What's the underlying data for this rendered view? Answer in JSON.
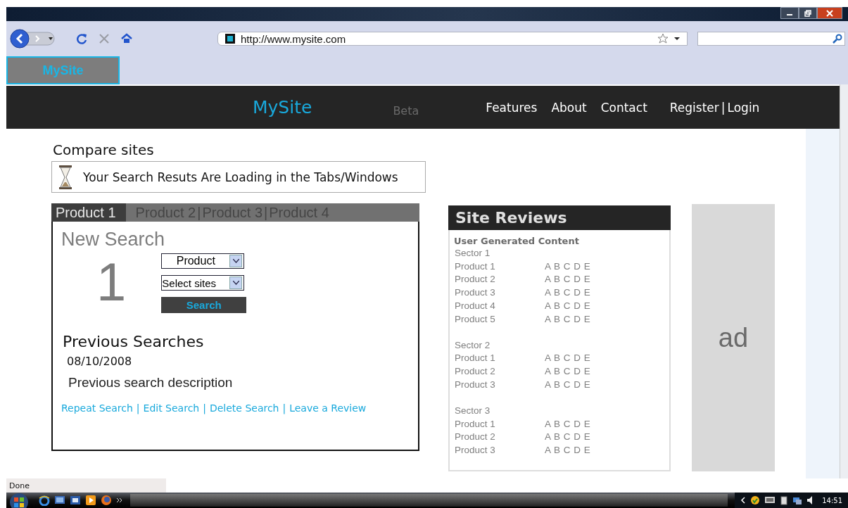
{
  "toolbar": {
    "address": "http://www.mysite.com"
  },
  "tabs": [
    {
      "label": "MySite",
      "selected": true
    }
  ],
  "site": {
    "logo": "MySite",
    "badge": "Beta",
    "nav": [
      "Features",
      "About",
      "Contact"
    ],
    "account": {
      "register": "Register",
      "separator": "|",
      "login": "Login"
    }
  },
  "compare": {
    "title": "Compare sites",
    "notice": "Your Search Resuts Are Loading in the Tabs/Windows"
  },
  "product_tabs": [
    {
      "label": "Product 1",
      "selected": true
    },
    {
      "label": "Product 2",
      "selected": false
    },
    {
      "label": "Product 3",
      "selected": false
    },
    {
      "label": "Product 4",
      "selected": false
    }
  ],
  "tab_separator": "|",
  "new_search": {
    "title": "New Search",
    "step": "1",
    "product_select": "Product",
    "sites_select": "Select sites",
    "button": "Search"
  },
  "previous": {
    "title": "Previous Searches",
    "date": "08/10/2008",
    "description": "Previous search description",
    "separator": "|",
    "actions": [
      "Repeat Search",
      "Edit Search",
      "Delete Search",
      "Leave a Review"
    ]
  },
  "reviews": {
    "title": "Site Reviews",
    "subtitle": "User Generated Content",
    "sectors": [
      {
        "name": "Sector 1",
        "products": [
          {
            "name": "Product 1",
            "grades": "A B C D E"
          },
          {
            "name": "Product 2",
            "grades": "A B C D E"
          },
          {
            "name": "Product 3",
            "grades": "A B C D E"
          },
          {
            "name": "Product 4",
            "grades": "A B C D E"
          },
          {
            "name": "Product 5",
            "grades": "A B C D E"
          }
        ]
      },
      {
        "name": "Sector 2",
        "products": [
          {
            "name": "Product 1",
            "grades": "A B C D E"
          },
          {
            "name": "Product 2",
            "grades": "A B C D E"
          },
          {
            "name": "Product 3",
            "grades": "A B C D E"
          }
        ]
      },
      {
        "name": "Sector 3",
        "products": [
          {
            "name": "Product 1",
            "grades": "A B C D E"
          },
          {
            "name": "Product 2",
            "grades": "A B C D E"
          },
          {
            "name": "Product 3",
            "grades": "A B C D E"
          }
        ]
      }
    ]
  },
  "ad": {
    "label": "ad"
  },
  "status_bar": {
    "text": "Done"
  },
  "taskbar": {
    "time": "14:51"
  }
}
